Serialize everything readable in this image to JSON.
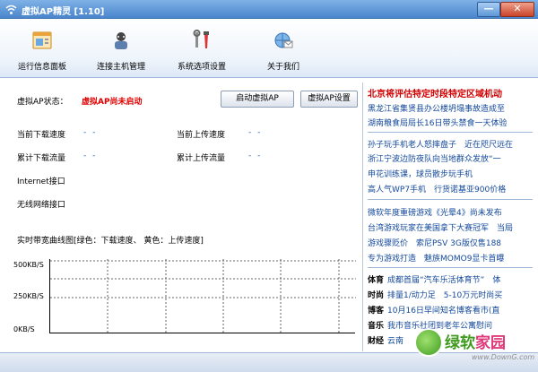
{
  "window": {
    "title": "虚拟AP精灵 [1.10]",
    "min_label": "—",
    "close_label": "✕"
  },
  "toolbar": {
    "items": [
      {
        "label": "运行信息面板",
        "icon": "window-panel-icon"
      },
      {
        "label": "连接主机管理",
        "icon": "user-host-icon"
      },
      {
        "label": "系统选项设置",
        "icon": "tools-icon"
      },
      {
        "label": "关于我们",
        "icon": "globe-mail-icon"
      }
    ]
  },
  "main": {
    "ap_status_label": "虚拟AP状态：",
    "ap_status_value": "虚拟AP尚未启动",
    "start_button": "启动虚拟AP",
    "settings_button": "虚拟AP设置",
    "stats": {
      "download_speed_label": "当前下载速度",
      "download_speed_value": "- -",
      "upload_speed_label": "当前上传速度",
      "upload_speed_value": "- -",
      "total_download_label": "累计下载流量",
      "total_download_value": "- -",
      "total_upload_label": "累计上传流量",
      "total_upload_value": "- -",
      "internet_iface_label": "Internet接口",
      "wireless_iface_label": "无线网络接口"
    },
    "chart_title": "实时带宽曲线图[绿色：下载速度、 黄色：上传速度]"
  },
  "chart_data": {
    "type": "line",
    "title": "实时带宽曲线图[绿色：下载速度、 黄色：上传速度]",
    "ytick_labels": [
      "500KB/S",
      "250KB/S",
      "0KB/S"
    ],
    "ylim": [
      0,
      500
    ],
    "grid": true,
    "series": [
      {
        "name": "下载速度",
        "color": "#00a000",
        "values": []
      },
      {
        "name": "上传速度",
        "color": "#e0c000",
        "values": []
      }
    ]
  },
  "news": {
    "headline": "北京将评估特定时段特定区域机动",
    "block1": [
      "黑龙江省集贤县办公楼坍塌事故造成至",
      "湖南粮食局局长16日带头禁食一天体验"
    ],
    "block2": [
      "孙子玩手机老人怒摔盘子　近在咫尺远在",
      "浙江宁波边防夜队向当地群众发放“一",
      "申花训练课，球员散步玩手机",
      "高人气WP7手机　行货诺基亚900价格"
    ],
    "block3": [
      "微软年度重磅游戏《光晕4》尚未发布",
      "台湾游戏玩家在美国拿下大赛冠军　当局",
      "游戏骤贬价　索尼PSV 3G版仅售188",
      "专为游戏打造　魅族MOMO9显卡首曝"
    ],
    "categories": [
      {
        "cat": "体育",
        "text": "成都首届“汽车乐活体育节”　体"
      },
      {
        "cat": "时尚",
        "text": "排量1/动力足　5-10万元时尚买"
      },
      {
        "cat": "博客",
        "text": "10月16日早间知名博客看市(直"
      },
      {
        "cat": "音乐",
        "text": "我市音乐社团到老年公寓慰问"
      },
      {
        "cat": "财经",
        "text": "云南"
      }
    ]
  },
  "watermark": {
    "brand_green": "绿软",
    "brand_pink": "家园",
    "url": "www.DownG.com"
  },
  "colors": {
    "status_red": "#e00000",
    "news_red": "#d10000",
    "news_blue": "#13489b",
    "title_bar": "#4a86cd"
  }
}
